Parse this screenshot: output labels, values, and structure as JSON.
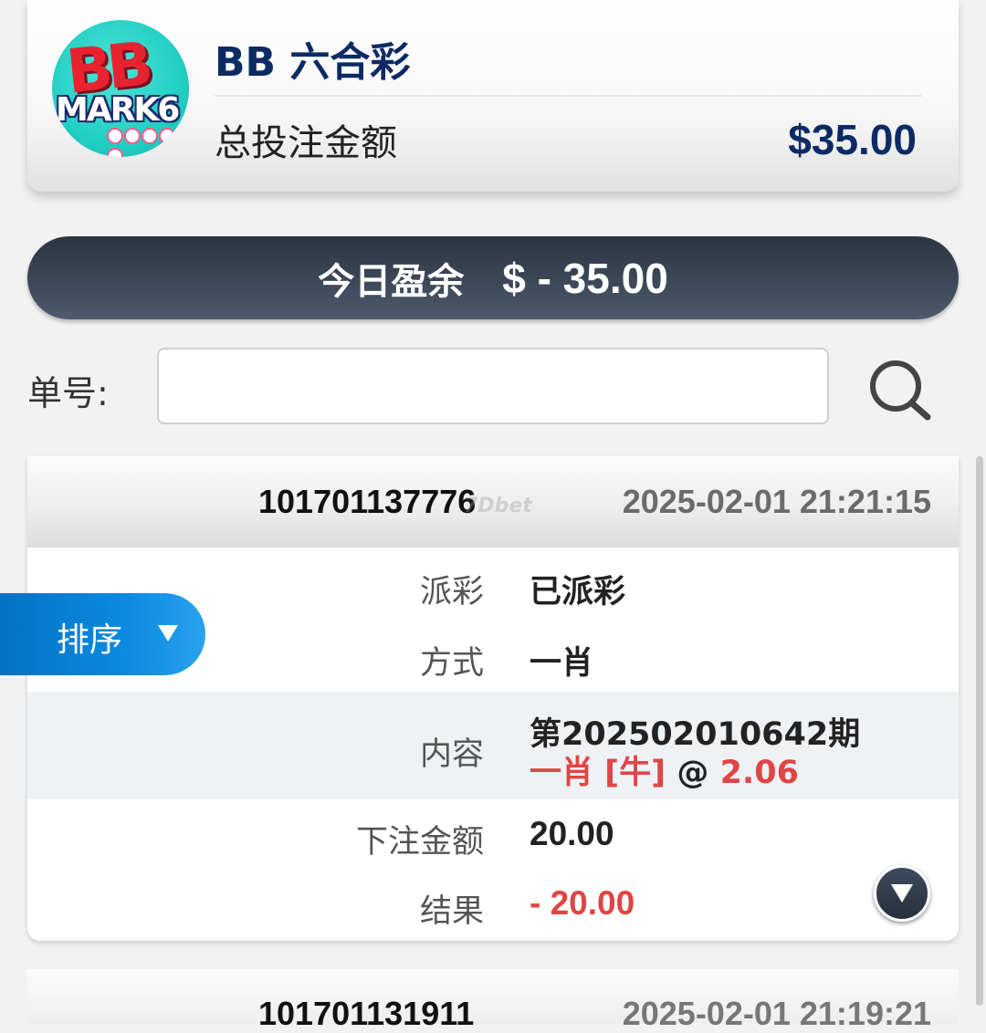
{
  "header": {
    "logo_text_top": "BB",
    "logo_text_bottom": "MARK6",
    "title": "BB 六合彩",
    "total_label": "总投注金额",
    "total_value": "$35.00"
  },
  "profit": {
    "label": "今日盈余",
    "value": "$ - 35.00"
  },
  "search": {
    "label": "单号:",
    "input_value": "",
    "icon": "search-icon"
  },
  "sort": {
    "label": "排序",
    "icon": "caret-down-icon"
  },
  "bets": [
    {
      "id": "101701137776",
      "watermark": "7Dbet",
      "time": "2025-02-01 21:21:15",
      "rows": {
        "payout_label": "派彩",
        "payout_value": "已派彩",
        "method_label": "方式",
        "method_value": "一肖",
        "content_label": "内容",
        "content_issue": "第202502010642期",
        "content_pick": "一肖 [牛]",
        "content_at": " @ ",
        "content_odds": "2.06",
        "stake_label": "下注金额",
        "stake_value": "20.00",
        "result_label": "结果",
        "result_value": "- 20.00"
      }
    },
    {
      "id": "101701131911",
      "time": "2025-02-01 21:19:21"
    }
  ],
  "colors": {
    "brand_navy": "#0c2a63",
    "profit_bar": "#3b4657",
    "loss_red": "#e04545",
    "sort_blue": "#0a8ae0"
  }
}
